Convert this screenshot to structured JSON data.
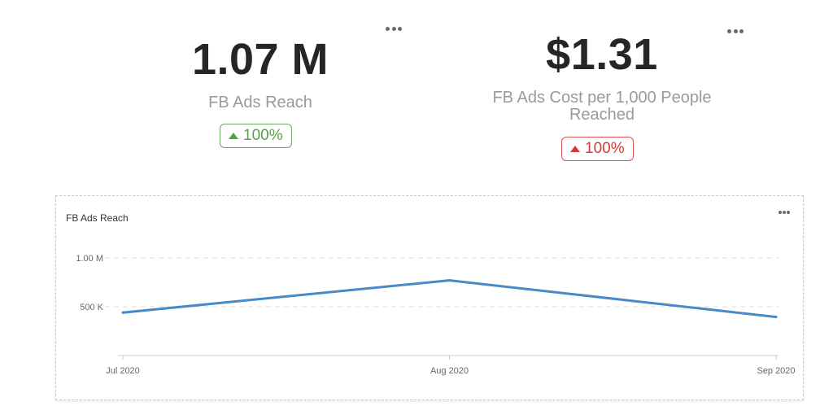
{
  "kpis": [
    {
      "value": "1.07 M",
      "label": "FB Ads Reach",
      "change": "100%",
      "trend": "up",
      "status_color": "#5a9e4b"
    },
    {
      "value": "$1.31",
      "label": "FB Ads Cost per 1,000 People Reached",
      "change": "100%",
      "trend": "up",
      "status_color": "#cf3b37"
    }
  ],
  "icons": {
    "menu": "more-horizontal-icon",
    "trend": "triangle-up-icon"
  },
  "chart_data": {
    "type": "line",
    "title": "FB Ads Reach",
    "categories": [
      "Jul 2020",
      "Aug 2020",
      "Sep 2020"
    ],
    "series": [
      {
        "values": [
          440000,
          770000,
          395000
        ],
        "color": "#4a89c8"
      }
    ],
    "yticks": [
      {
        "value": 500000,
        "label": "500 K"
      },
      {
        "value": 1000000,
        "label": "1.00 M"
      }
    ],
    "ylim": [
      0,
      1000000
    ],
    "grid": true,
    "legend": "none"
  }
}
